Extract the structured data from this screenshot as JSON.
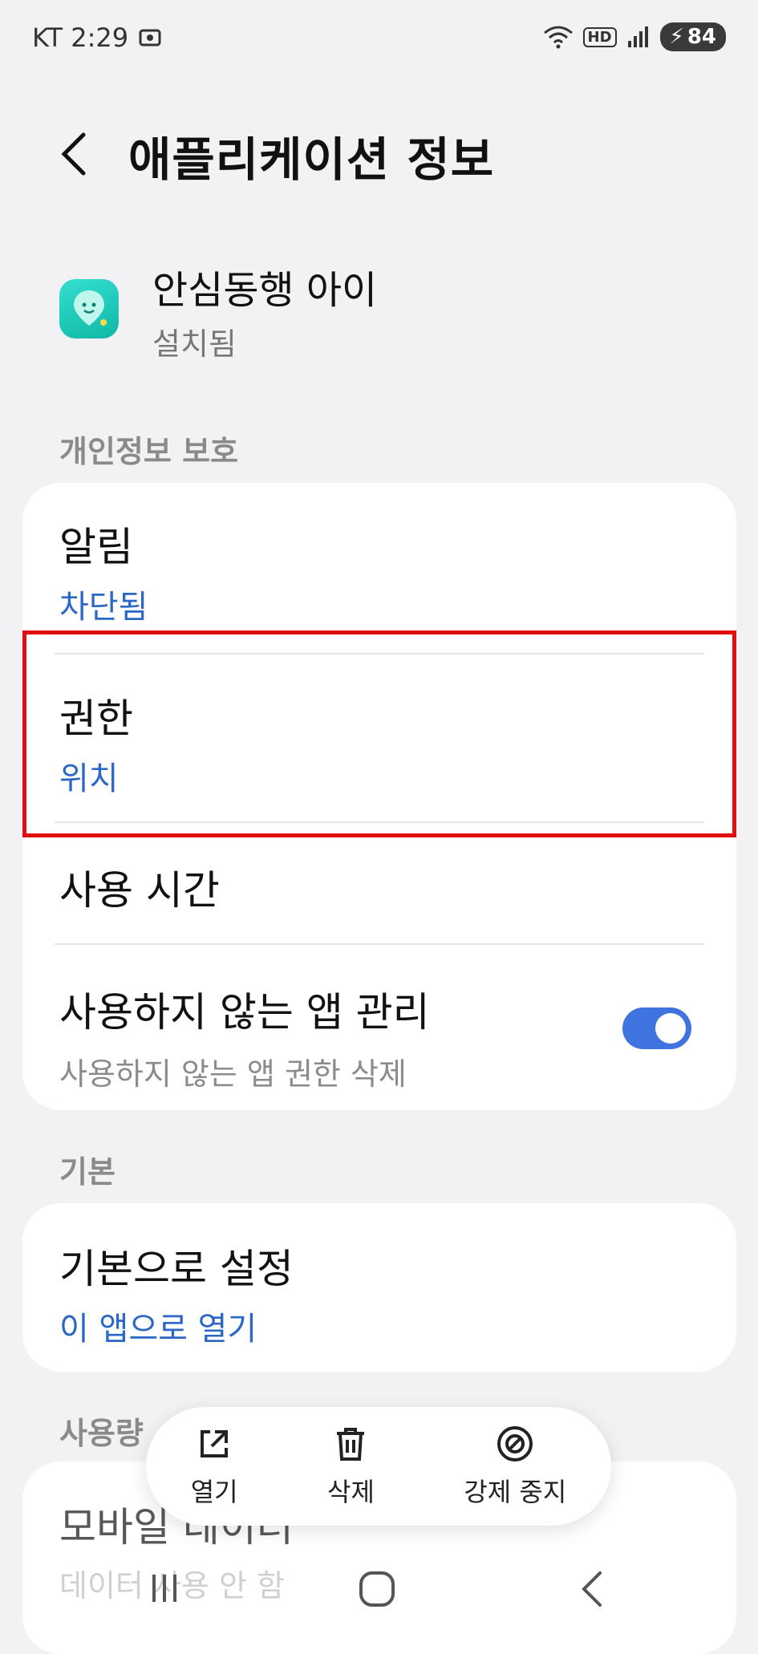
{
  "status_bar": {
    "carrier_time": "KT 2:29",
    "battery": "84",
    "network": "HD"
  },
  "header": {
    "title": "애플리케이션 정보"
  },
  "app": {
    "name": "안심동행 아이",
    "status": "설치됨"
  },
  "sections": {
    "privacy": "개인정보 보호",
    "defaults": "기본",
    "usage": "사용량"
  },
  "items": {
    "notifications": {
      "title": "알림",
      "value": "차단됨"
    },
    "permissions": {
      "title": "권한",
      "value": "위치"
    },
    "usage_time": {
      "title": "사용 시간"
    },
    "unused_apps": {
      "title": "사용하지 않는 앱 관리",
      "desc": "사용하지 않는 앱 권한 삭제",
      "enabled": true
    },
    "set_default": {
      "title": "기본으로 설정",
      "value": "이 앱으로 열기"
    },
    "mobile_data": {
      "title": "모바일 데이터",
      "value": "데이터 사용 안 함"
    }
  },
  "actions": {
    "open": "열기",
    "delete": "삭제",
    "force_stop": "강제 중지"
  },
  "colors": {
    "accent_blue": "#2b67c7",
    "toggle_on": "#3f73e0",
    "highlight": "#e01010"
  }
}
